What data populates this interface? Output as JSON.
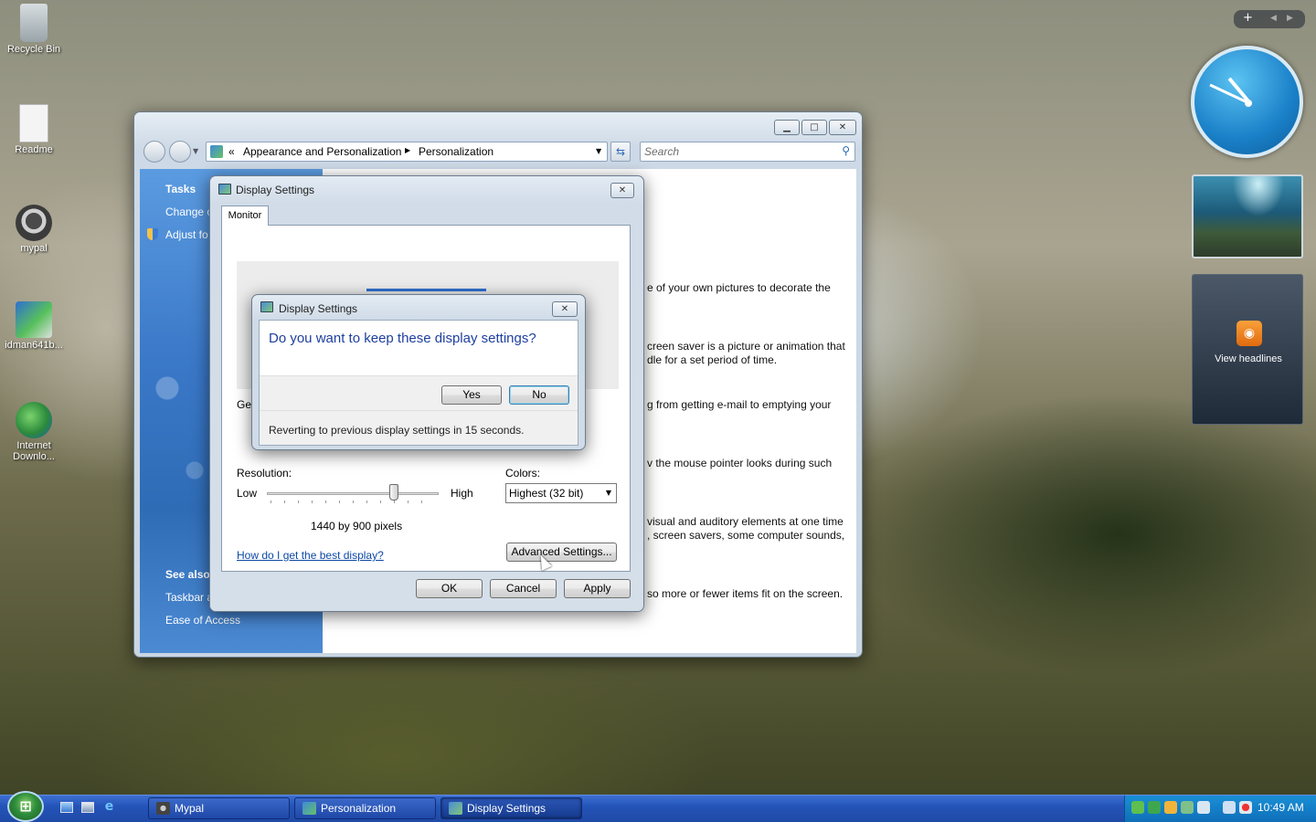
{
  "desktop": {
    "icons": [
      {
        "label": "Recycle Bin"
      },
      {
        "label": "Readme"
      },
      {
        "label": "mypal"
      },
      {
        "label": "idman641b..."
      },
      {
        "label": "Internet Downlo..."
      }
    ]
  },
  "explorer": {
    "breadcrumb": {
      "root": "«",
      "part1": "Appearance and Personalization",
      "part2": "Personalization"
    },
    "search_placeholder": "Search",
    "sidebar": {
      "tasks_heading": "Tasks",
      "task1": "Change c",
      "task2": "Adjust fo",
      "see_also_heading": "See also",
      "see1": "Taskbar a",
      "see2": "Ease of Access"
    },
    "content_snippets": [
      "e of your own pictures to decorate the",
      "creen saver is a picture or animation that\ndle for a set period of time.",
      "g from getting e-mail to emptying your",
      "v the mouse pointer looks during such",
      "visual and auditory elements at one time\n, screen savers, some computer sounds,",
      "so more or fewer items fit on the screen."
    ]
  },
  "display_settings": {
    "title": "Display Settings",
    "tab": "Monitor",
    "gen_label": "Ger",
    "resolution_label": "Resolution:",
    "low": "Low",
    "high": "High",
    "resolution_value": "1440 by 900 pixels",
    "colors_label": "Colors:",
    "colors_value": "Highest (32 bit)",
    "help_link": "How do I get the best display?",
    "advanced_button": "Advanced Settings...",
    "ok": "OK",
    "cancel": "Cancel",
    "apply": "Apply"
  },
  "confirm": {
    "title": "Display Settings",
    "question": "Do you want to keep these display settings?",
    "yes": "Yes",
    "no": "No",
    "countdown": "Reverting to previous display settings in 15 seconds."
  },
  "sidebar_gadgets": {
    "feed_label": "View headlines"
  },
  "taskbar": {
    "items": [
      {
        "label": "Mypal"
      },
      {
        "label": "Personalization"
      },
      {
        "label": "Display Settings"
      }
    ],
    "clock": "10:49 AM"
  },
  "colors": {
    "taskbar": "#1f4aa6",
    "link": "#0b48a5",
    "heading_blue": "#1e3fa0",
    "sidebar_blue": "#3a78c8"
  }
}
